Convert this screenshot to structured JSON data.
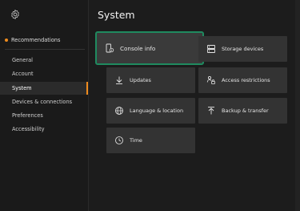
{
  "title": "System",
  "sidebar": {
    "recommendations": "Recommendations",
    "items": [
      {
        "label": "General"
      },
      {
        "label": "Account"
      },
      {
        "label": "System"
      },
      {
        "label": "Devices & connections"
      },
      {
        "label": "Preferences"
      },
      {
        "label": "Accessibility"
      }
    ],
    "active": "System"
  },
  "tiles": {
    "console_info": "Console info",
    "storage_devices": "Storage devices",
    "updates": "Updates",
    "access_restrictions": "Access restrictions",
    "language_location": "Language & location",
    "backup_transfer": "Backup & transfer",
    "time": "Time"
  },
  "colors": {
    "accent": "#f08c1e",
    "focus": "#1f8a5f",
    "tile": "#333333",
    "background": "#1c1c1c"
  },
  "icons": {
    "settings": "gear-icon",
    "console_info": "console-icon",
    "storage_devices": "storage-icon",
    "updates": "download-icon",
    "access_restrictions": "access-icon",
    "language_location": "globe-icon",
    "backup_transfer": "upload-icon",
    "time": "clock-icon"
  }
}
